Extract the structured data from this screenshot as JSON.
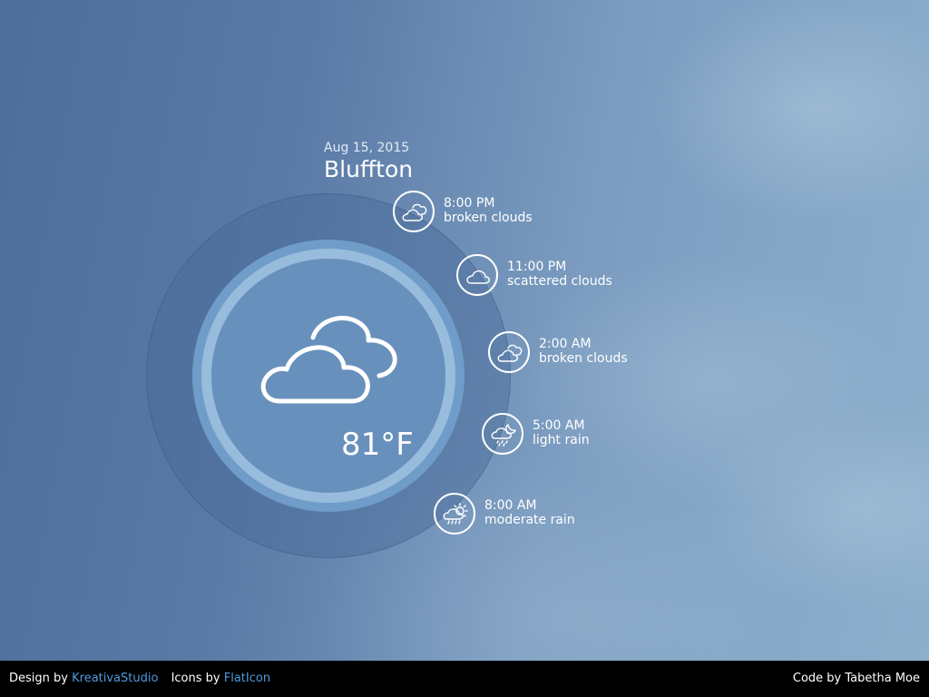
{
  "header": {
    "date": "Aug 15, 2015",
    "city": "Bluffton"
  },
  "current": {
    "temperature": "81°F",
    "icon": "broken-clouds-icon"
  },
  "forecast": [
    {
      "time": "8:00 PM",
      "description": "broken clouds",
      "icon": "broken-clouds-icon"
    },
    {
      "time": "11:00 PM",
      "description": "scattered clouds",
      "icon": "scattered-clouds-icon"
    },
    {
      "time": "2:00 AM",
      "description": "broken clouds",
      "icon": "broken-clouds-icon"
    },
    {
      "time": "5:00 AM",
      "description": "light rain",
      "icon": "night-light-rain-icon"
    },
    {
      "time": "8:00 AM",
      "description": "moderate rain",
      "icon": "sun-rain-icon"
    }
  ],
  "footer": {
    "design_label": "Design by",
    "design_link": "KreativaStudio",
    "icons_label": "Icons by",
    "icons_link": "FlatIcon",
    "code_credit": "Code by Tabetha Moe"
  },
  "colors": {
    "link": "#4f9be0",
    "footer_bg": "#000000",
    "ring_mid": "#6f9cc8",
    "ring_light": "#97bcdc"
  }
}
